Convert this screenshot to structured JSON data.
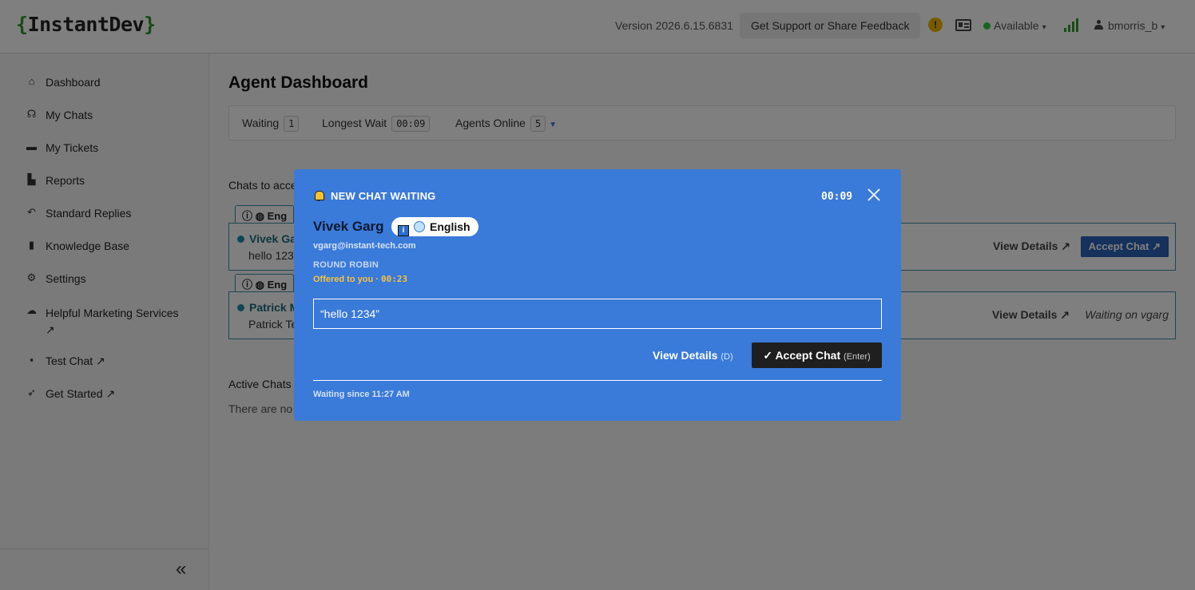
{
  "header": {
    "logo_open": "{",
    "logo_text": "InstantDev",
    "logo_close": "}",
    "version": "Version 2026.6.15.6831",
    "support_label": "Get Support or Share Feedback",
    "warning_glyph": "!",
    "status_label": "Available",
    "status_color": "#2ecc40",
    "username": "bmorris_b"
  },
  "sidebar": {
    "items": [
      {
        "label": "Dashboard",
        "icon": "home-icon"
      },
      {
        "label": "My Chats",
        "icon": "headset-icon"
      },
      {
        "label": "My Tickets",
        "icon": "ticket-icon"
      },
      {
        "label": "Reports",
        "icon": "chart-icon"
      },
      {
        "label": "Standard Replies",
        "icon": "reply-icon"
      },
      {
        "label": "Knowledge Base",
        "icon": "book-icon"
      },
      {
        "label": "Settings",
        "icon": "gear-icon"
      },
      {
        "label": "Helpful Marketing Services ↗",
        "icon": "comments-icon"
      },
      {
        "label": "Test Chat ↗",
        "icon": "comment-icon"
      },
      {
        "label": "Get Started ↗",
        "icon": "rocket-icon"
      }
    ],
    "collapse_glyph": "«"
  },
  "main": {
    "title": "Agent Dashboard",
    "stats": {
      "waiting_label": "Waiting",
      "waiting_value": "1",
      "longest_label": "Longest Wait",
      "longest_value": "00:09",
      "agents_label": "Agents Online",
      "agents_value": "5"
    },
    "chats_to_accept_label": "Chats to acce",
    "rows": [
      {
        "tag": "Eng",
        "name": "Vivek Ga",
        "message": "hello 123",
        "view_label": "View Details",
        "accept_label": "Accept Chat"
      },
      {
        "tag": "Eng",
        "name": "Patrick M",
        "message": "Patrick Te",
        "view_label": "View Details",
        "waiting_text": "Waiting on vgarg"
      }
    ],
    "active_chats_label": "Active Chats",
    "no_active_text": "There are no"
  },
  "modal": {
    "heading": "NEW CHAT WAITING",
    "timer": "00:09",
    "customer_name": "Vivek Garg",
    "info_glyph": "i",
    "language": "English",
    "email": "vgarg@instant-tech.com",
    "routing": "ROUND ROBIN",
    "offered_text": "Offered to you · ",
    "offered_timer": "00:23",
    "quote": "“hello 1234”",
    "view_label": "View Details",
    "view_hint": "(D)",
    "accept_label": "✓ Accept Chat",
    "accept_hint": "(Enter)",
    "waiting_since": "Waiting since 11:27 AM",
    "accent_color": "#3a7ad9"
  }
}
